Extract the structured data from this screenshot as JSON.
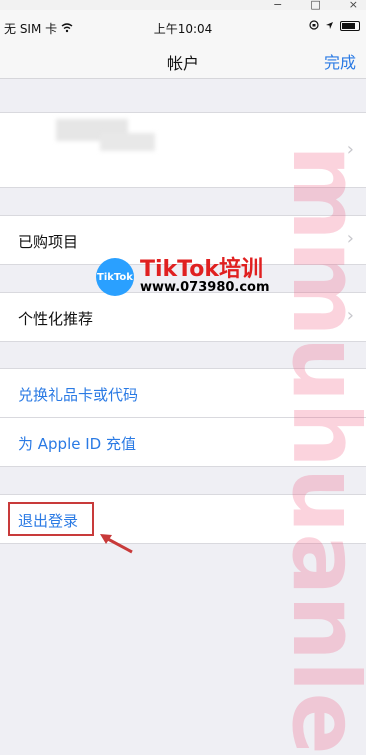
{
  "window": {
    "controls": [
      "−",
      "□",
      "×"
    ]
  },
  "status": {
    "carrier": "无 SIM 卡",
    "wifi_icon": "wifi-icon",
    "time": "上午10:04",
    "right_icons": [
      "lock-rotation-icon",
      "location-icon",
      "battery-icon"
    ]
  },
  "nav": {
    "title": "帐户",
    "done": "完成"
  },
  "rows": {
    "purchased": "已购项目",
    "personalized": "个性化推荐",
    "redeem": "兑换礼品卡或代码",
    "add_funds": "为 Apple ID 充值",
    "sign_out": "退出登录"
  },
  "watermark": {
    "text": "mmuhuanle",
    "logo_badge": "TikTok",
    "logo_brand": "TikTok培训",
    "logo_url": "www.073980.com"
  },
  "colors": {
    "link": "#2a7ae4",
    "highlight": "#c83a3a",
    "background": "#efeff4"
  }
}
